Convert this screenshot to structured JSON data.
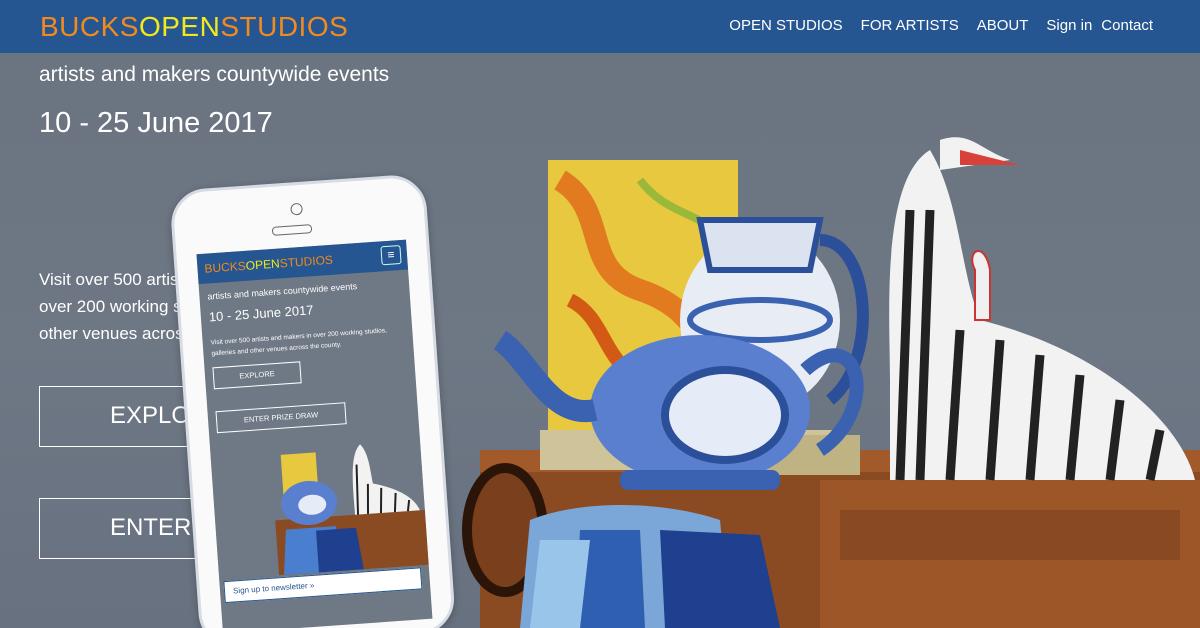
{
  "nav": {
    "logo_part1": "BUCKS",
    "logo_part2": "OPEN",
    "logo_part3": "STUDIOS",
    "links": [
      "OPEN STUDIOS",
      "FOR ARTISTS",
      "ABOUT",
      "Sign in",
      "Contact"
    ]
  },
  "hero": {
    "tagline": "artists and makers countywide events",
    "dates": "10 - 25 June 2017",
    "intro": "Visit over 500 artists and makers in over 200 working studios, galleries and other venues across the county.",
    "cta_explore": "EXPLORE",
    "cta_prize": "ENTER PRIZE DRAW"
  },
  "mobile": {
    "logo_part1": "BUCKS",
    "logo_part2": "OPEN",
    "logo_part3": "STUDIOS",
    "menu_icon": "≡",
    "tagline": "artists and makers countywide events",
    "dates": "10 - 25 June 2017",
    "intro": "Visit over 500 artists and makers in over 200 working studios, galleries and other venues across the county.",
    "explore": "EXPLORE",
    "prize": "ENTER PRIZE DRAW",
    "newsletter": "Sign up to newsletter »"
  },
  "colors": {
    "nav_bg": "#255691",
    "logo_orange": "#f28a1d",
    "logo_yellow": "#f2e81c"
  }
}
